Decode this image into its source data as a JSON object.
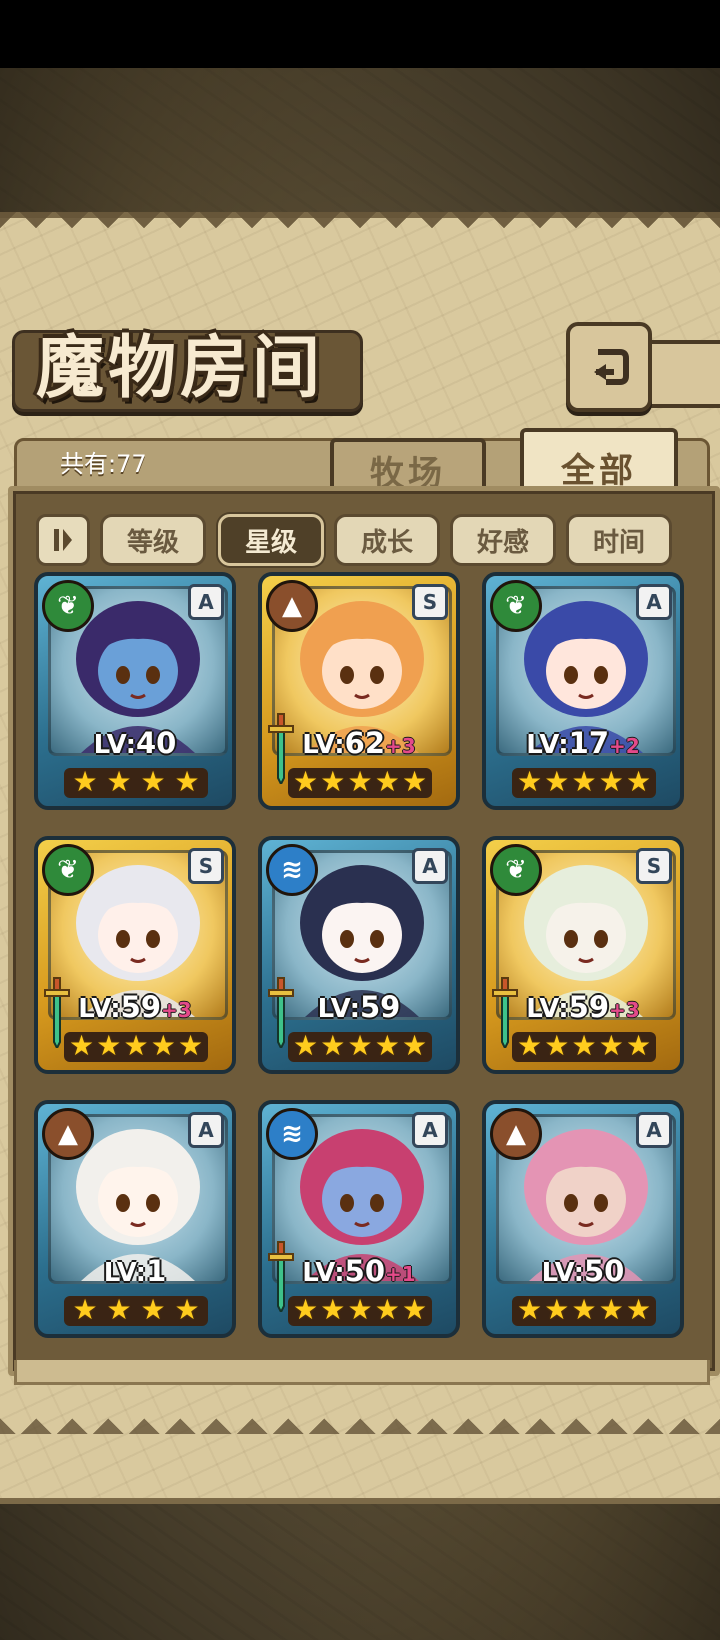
{
  "title": "魔物房间",
  "count_label": "共有:77",
  "tabs": [
    {
      "label": "牧场",
      "active": false
    },
    {
      "label": "全部",
      "active": true
    }
  ],
  "sort_options": [
    {
      "label": "等级",
      "active": false
    },
    {
      "label": "星级",
      "active": true
    },
    {
      "label": "成长",
      "active": false
    },
    {
      "label": "好感",
      "active": false
    },
    {
      "label": "时间",
      "active": false
    }
  ],
  "monsters": [
    {
      "element": "leaf",
      "rank": "A",
      "frame": "blue",
      "lv_prefix": "LV:",
      "level": "40",
      "bonus": "",
      "stars": 4,
      "equip_sword": false
    },
    {
      "element": "rock",
      "rank": "S",
      "frame": "gold",
      "lv_prefix": "LV:",
      "level": "62",
      "bonus": "+3",
      "stars": 5,
      "equip_sword": true
    },
    {
      "element": "leaf",
      "rank": "A",
      "frame": "blue",
      "lv_prefix": "LV:",
      "level": "17",
      "bonus": "+2",
      "stars": 5,
      "equip_sword": false
    },
    {
      "element": "leaf",
      "rank": "S",
      "frame": "gold",
      "lv_prefix": "LV:",
      "level": "59",
      "bonus": "+3",
      "stars": 5,
      "equip_sword": true
    },
    {
      "element": "water",
      "rank": "A",
      "frame": "blue",
      "lv_prefix": "LV:",
      "level": "59",
      "bonus": "",
      "stars": 5,
      "equip_sword": true
    },
    {
      "element": "leaf",
      "rank": "S",
      "frame": "gold",
      "lv_prefix": "LV:",
      "level": "59",
      "bonus": "+3",
      "stars": 5,
      "equip_sword": true
    },
    {
      "element": "rock",
      "rank": "A",
      "frame": "blue",
      "lv_prefix": "LV:",
      "level": "1",
      "bonus": "",
      "stars": 4,
      "equip_sword": false
    },
    {
      "element": "water",
      "rank": "A",
      "frame": "blue",
      "lv_prefix": "LV:",
      "level": "50",
      "bonus": "+1",
      "stars": 5,
      "equip_sword": true
    },
    {
      "element": "rock",
      "rank": "A",
      "frame": "blue",
      "lv_prefix": "LV:",
      "level": "50",
      "bonus": "",
      "stars": 5,
      "equip_sword": false
    }
  ],
  "colors": {
    "leaf": "#2f8a3a",
    "rock": "#8a4f2c",
    "water": "#2d7fc8",
    "star": "#ffcc1e",
    "bonus": "#e44a8a"
  }
}
